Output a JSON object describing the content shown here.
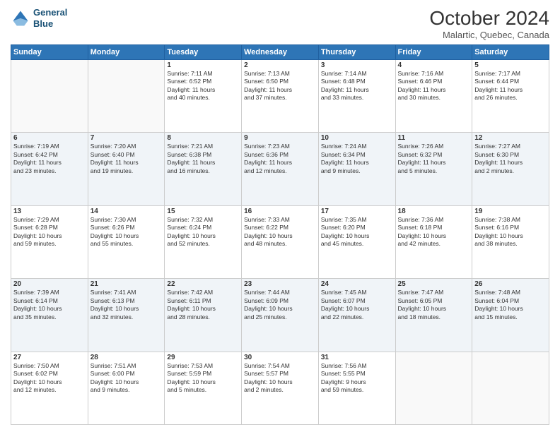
{
  "header": {
    "logo_line1": "General",
    "logo_line2": "Blue",
    "month_title": "October 2024",
    "location": "Malartic, Quebec, Canada"
  },
  "days_of_week": [
    "Sunday",
    "Monday",
    "Tuesday",
    "Wednesday",
    "Thursday",
    "Friday",
    "Saturday"
  ],
  "weeks": [
    [
      {
        "day": "",
        "info": ""
      },
      {
        "day": "",
        "info": ""
      },
      {
        "day": "1",
        "info": "Sunrise: 7:11 AM\nSunset: 6:52 PM\nDaylight: 11 hours\nand 40 minutes."
      },
      {
        "day": "2",
        "info": "Sunrise: 7:13 AM\nSunset: 6:50 PM\nDaylight: 11 hours\nand 37 minutes."
      },
      {
        "day": "3",
        "info": "Sunrise: 7:14 AM\nSunset: 6:48 PM\nDaylight: 11 hours\nand 33 minutes."
      },
      {
        "day": "4",
        "info": "Sunrise: 7:16 AM\nSunset: 6:46 PM\nDaylight: 11 hours\nand 30 minutes."
      },
      {
        "day": "5",
        "info": "Sunrise: 7:17 AM\nSunset: 6:44 PM\nDaylight: 11 hours\nand 26 minutes."
      }
    ],
    [
      {
        "day": "6",
        "info": "Sunrise: 7:19 AM\nSunset: 6:42 PM\nDaylight: 11 hours\nand 23 minutes."
      },
      {
        "day": "7",
        "info": "Sunrise: 7:20 AM\nSunset: 6:40 PM\nDaylight: 11 hours\nand 19 minutes."
      },
      {
        "day": "8",
        "info": "Sunrise: 7:21 AM\nSunset: 6:38 PM\nDaylight: 11 hours\nand 16 minutes."
      },
      {
        "day": "9",
        "info": "Sunrise: 7:23 AM\nSunset: 6:36 PM\nDaylight: 11 hours\nand 12 minutes."
      },
      {
        "day": "10",
        "info": "Sunrise: 7:24 AM\nSunset: 6:34 PM\nDaylight: 11 hours\nand 9 minutes."
      },
      {
        "day": "11",
        "info": "Sunrise: 7:26 AM\nSunset: 6:32 PM\nDaylight: 11 hours\nand 5 minutes."
      },
      {
        "day": "12",
        "info": "Sunrise: 7:27 AM\nSunset: 6:30 PM\nDaylight: 11 hours\nand 2 minutes."
      }
    ],
    [
      {
        "day": "13",
        "info": "Sunrise: 7:29 AM\nSunset: 6:28 PM\nDaylight: 10 hours\nand 59 minutes."
      },
      {
        "day": "14",
        "info": "Sunrise: 7:30 AM\nSunset: 6:26 PM\nDaylight: 10 hours\nand 55 minutes."
      },
      {
        "day": "15",
        "info": "Sunrise: 7:32 AM\nSunset: 6:24 PM\nDaylight: 10 hours\nand 52 minutes."
      },
      {
        "day": "16",
        "info": "Sunrise: 7:33 AM\nSunset: 6:22 PM\nDaylight: 10 hours\nand 48 minutes."
      },
      {
        "day": "17",
        "info": "Sunrise: 7:35 AM\nSunset: 6:20 PM\nDaylight: 10 hours\nand 45 minutes."
      },
      {
        "day": "18",
        "info": "Sunrise: 7:36 AM\nSunset: 6:18 PM\nDaylight: 10 hours\nand 42 minutes."
      },
      {
        "day": "19",
        "info": "Sunrise: 7:38 AM\nSunset: 6:16 PM\nDaylight: 10 hours\nand 38 minutes."
      }
    ],
    [
      {
        "day": "20",
        "info": "Sunrise: 7:39 AM\nSunset: 6:14 PM\nDaylight: 10 hours\nand 35 minutes."
      },
      {
        "day": "21",
        "info": "Sunrise: 7:41 AM\nSunset: 6:13 PM\nDaylight: 10 hours\nand 32 minutes."
      },
      {
        "day": "22",
        "info": "Sunrise: 7:42 AM\nSunset: 6:11 PM\nDaylight: 10 hours\nand 28 minutes."
      },
      {
        "day": "23",
        "info": "Sunrise: 7:44 AM\nSunset: 6:09 PM\nDaylight: 10 hours\nand 25 minutes."
      },
      {
        "day": "24",
        "info": "Sunrise: 7:45 AM\nSunset: 6:07 PM\nDaylight: 10 hours\nand 22 minutes."
      },
      {
        "day": "25",
        "info": "Sunrise: 7:47 AM\nSunset: 6:05 PM\nDaylight: 10 hours\nand 18 minutes."
      },
      {
        "day": "26",
        "info": "Sunrise: 7:48 AM\nSunset: 6:04 PM\nDaylight: 10 hours\nand 15 minutes."
      }
    ],
    [
      {
        "day": "27",
        "info": "Sunrise: 7:50 AM\nSunset: 6:02 PM\nDaylight: 10 hours\nand 12 minutes."
      },
      {
        "day": "28",
        "info": "Sunrise: 7:51 AM\nSunset: 6:00 PM\nDaylight: 10 hours\nand 9 minutes."
      },
      {
        "day": "29",
        "info": "Sunrise: 7:53 AM\nSunset: 5:59 PM\nDaylight: 10 hours\nand 5 minutes."
      },
      {
        "day": "30",
        "info": "Sunrise: 7:54 AM\nSunset: 5:57 PM\nDaylight: 10 hours\nand 2 minutes."
      },
      {
        "day": "31",
        "info": "Sunrise: 7:56 AM\nSunset: 5:55 PM\nDaylight: 9 hours\nand 59 minutes."
      },
      {
        "day": "",
        "info": ""
      },
      {
        "day": "",
        "info": ""
      }
    ]
  ]
}
